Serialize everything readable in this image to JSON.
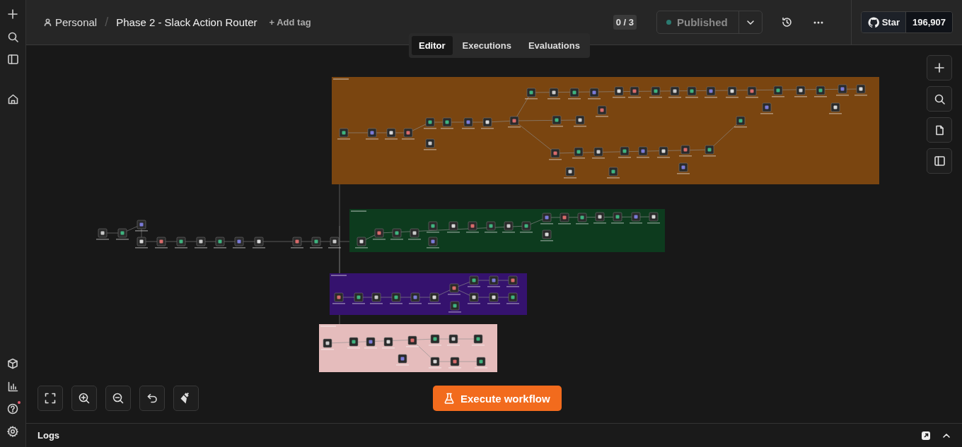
{
  "breadcrumb": {
    "owner": "Personal",
    "separator": "/",
    "workflow": "Phase 2 - Slack Action Router",
    "add_tag": "+ Add tag"
  },
  "tabs": [
    {
      "label": "Editor",
      "selected": true
    },
    {
      "label": "Executions",
      "selected": false
    },
    {
      "label": "Evaluations",
      "selected": false
    }
  ],
  "counter": "0 / 3",
  "publish": {
    "label": "Published",
    "active": true
  },
  "github": {
    "label": "Star",
    "count": "196,907"
  },
  "execute_button": "Execute workflow",
  "logs": {
    "title": "Logs"
  }
}
